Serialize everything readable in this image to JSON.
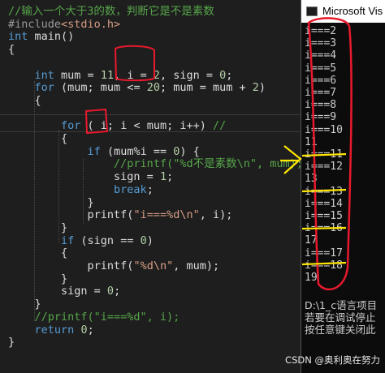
{
  "editor": {
    "lines": [
      {
        "parts": [
          {
            "cls": "cmt",
            "t": "//输入一个大于3的数，判断它是不是素数"
          }
        ]
      },
      {
        "parts": [
          {
            "cls": "pp",
            "t": "#include"
          },
          {
            "cls": "str",
            "t": "<stdio.h>"
          }
        ]
      },
      {
        "parts": [
          {
            "cls": "kw",
            "t": "int"
          },
          {
            "cls": "",
            "t": " main()"
          }
        ]
      },
      {
        "parts": [
          {
            "cls": "",
            "t": "{"
          }
        ]
      },
      {
        "parts": [
          {
            "cls": "",
            "t": ""
          }
        ]
      },
      {
        "parts": [
          {
            "cls": "",
            "t": "    "
          },
          {
            "cls": "kw",
            "t": "int"
          },
          {
            "cls": "",
            "t": " mum = "
          },
          {
            "cls": "num",
            "t": "11"
          },
          {
            "cls": "",
            "t": ", i = "
          },
          {
            "cls": "num",
            "t": "2"
          },
          {
            "cls": "",
            "t": ", sign = "
          },
          {
            "cls": "num",
            "t": "0"
          },
          {
            "cls": "",
            "t": ";"
          }
        ]
      },
      {
        "parts": [
          {
            "cls": "",
            "t": "    "
          },
          {
            "cls": "kw",
            "t": "for"
          },
          {
            "cls": "",
            "t": " (mum; mum <= "
          },
          {
            "cls": "num",
            "t": "20"
          },
          {
            "cls": "",
            "t": "; mum = mum + "
          },
          {
            "cls": "num",
            "t": "2"
          },
          {
            "cls": "",
            "t": ")"
          }
        ]
      },
      {
        "parts": [
          {
            "cls": "",
            "t": "    {"
          }
        ]
      },
      {
        "parts": [
          {
            "cls": "",
            "t": ""
          }
        ]
      },
      {
        "parts": [
          {
            "cls": "",
            "t": "        "
          },
          {
            "cls": "kw",
            "t": "for"
          },
          {
            "cls": "",
            "t": " ( i; i < mum; i++) "
          },
          {
            "cls": "cmt",
            "t": "//"
          }
        ]
      },
      {
        "parts": [
          {
            "cls": "",
            "t": "        {"
          }
        ]
      },
      {
        "parts": [
          {
            "cls": "",
            "t": "            "
          },
          {
            "cls": "kw",
            "t": "if"
          },
          {
            "cls": "",
            "t": " (mum%i == "
          },
          {
            "cls": "num",
            "t": "0"
          },
          {
            "cls": "",
            "t": ") {"
          }
        ]
      },
      {
        "parts": [
          {
            "cls": "",
            "t": "                "
          },
          {
            "cls": "cmt",
            "t": "//printf(\"%d不是素数\\n\", mum);"
          }
        ]
      },
      {
        "parts": [
          {
            "cls": "",
            "t": "                sign = "
          },
          {
            "cls": "num",
            "t": "1"
          },
          {
            "cls": "",
            "t": ";"
          }
        ]
      },
      {
        "parts": [
          {
            "cls": "",
            "t": "                "
          },
          {
            "cls": "kw",
            "t": "break"
          },
          {
            "cls": "",
            "t": ";"
          }
        ]
      },
      {
        "parts": [
          {
            "cls": "",
            "t": "            }"
          }
        ]
      },
      {
        "parts": [
          {
            "cls": "",
            "t": "            printf("
          },
          {
            "cls": "str",
            "t": "\"i===%d\\n\""
          },
          {
            "cls": "",
            "t": ", i);"
          }
        ]
      },
      {
        "parts": [
          {
            "cls": "",
            "t": "        }"
          }
        ]
      },
      {
        "parts": [
          {
            "cls": "",
            "t": "        "
          },
          {
            "cls": "kw",
            "t": "if"
          },
          {
            "cls": "",
            "t": " (sign == "
          },
          {
            "cls": "num",
            "t": "0"
          },
          {
            "cls": "",
            "t": ")"
          }
        ]
      },
      {
        "parts": [
          {
            "cls": "",
            "t": "        {"
          }
        ]
      },
      {
        "parts": [
          {
            "cls": "",
            "t": "            printf("
          },
          {
            "cls": "str",
            "t": "\"%d\\n\""
          },
          {
            "cls": "",
            "t": ", mum);"
          }
        ]
      },
      {
        "parts": [
          {
            "cls": "",
            "t": "        }"
          }
        ]
      },
      {
        "parts": [
          {
            "cls": "",
            "t": "        sign = "
          },
          {
            "cls": "num",
            "t": "0"
          },
          {
            "cls": "",
            "t": ";"
          }
        ]
      },
      {
        "parts": [
          {
            "cls": "",
            "t": "    }"
          }
        ]
      },
      {
        "parts": [
          {
            "cls": "",
            "t": "    "
          },
          {
            "cls": "cmt",
            "t": "//printf(\"i===%d\", i);"
          }
        ]
      },
      {
        "parts": [
          {
            "cls": "",
            "t": "    "
          },
          {
            "cls": "kw",
            "t": "return"
          },
          {
            "cls": "",
            "t": " "
          },
          {
            "cls": "num",
            "t": "0"
          },
          {
            "cls": "",
            "t": ";"
          }
        ]
      },
      {
        "parts": [
          {
            "cls": "",
            "t": "}"
          }
        ]
      }
    ]
  },
  "console": {
    "title": "Microsoft Vis",
    "output": [
      "i===2",
      "i===3",
      "i===4",
      "i===5",
      "i===6",
      "i===7",
      "i===8",
      "i===9",
      "i===10",
      "11",
      "i===11",
      "i===12",
      "13",
      "i===13",
      "i===14",
      "i===15",
      "i===16",
      "17",
      "i===17",
      "i===18",
      "19"
    ],
    "footer": [
      "D:\\1_c语言项目",
      "若要在调试停止",
      "按任意键关闭此"
    ]
  },
  "watermark": "CSDN @奥利奥在努力",
  "colors": {
    "keyword": "#569cd6",
    "comment": "#57a64a",
    "string": "#d69d85",
    "annotation_red": "#e8192c",
    "annotation_yellow": "#ffe600"
  }
}
